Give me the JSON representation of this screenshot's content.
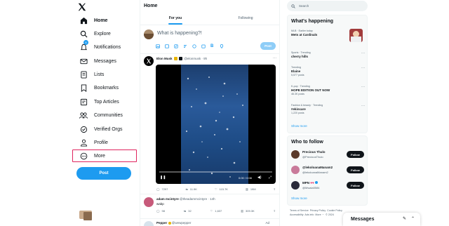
{
  "nav": {
    "items": [
      {
        "label": "Home",
        "icon": "home-icon"
      },
      {
        "label": "Explore",
        "icon": "search-icon"
      },
      {
        "label": "Notifications",
        "icon": "bell-icon",
        "badge": "8"
      },
      {
        "label": "Messages",
        "icon": "mail-icon"
      },
      {
        "label": "Lists",
        "icon": "lists-icon"
      },
      {
        "label": "Bookmarks",
        "icon": "bookmark-icon"
      },
      {
        "label": "Top Articles",
        "icon": "articles-icon"
      },
      {
        "label": "Communities",
        "icon": "communities-icon"
      },
      {
        "label": "Verified Orgs",
        "icon": "verified-icon"
      },
      {
        "label": "Profile",
        "icon": "person-icon"
      },
      {
        "label": "More",
        "icon": "more-circle-icon"
      }
    ],
    "post_button": "Post"
  },
  "main": {
    "title": "Home",
    "tabs": [
      {
        "label": "For you"
      },
      {
        "label": "Following"
      }
    ],
    "composer": {
      "placeholder": "What is happening?!",
      "post_label": "Post"
    },
    "tweets": [
      {
        "name": "Elon Musk",
        "handle": "@elonmusk · 9h",
        "video_time": "0:00 / 0:08",
        "stats": {
          "replies": "7297",
          "reposts": "11.9K",
          "likes": "115.7K",
          "views": "19M"
        }
      },
      {
        "name": "adam mcintyre",
        "handle": "@theadammcintyre · 14h",
        "text": "wabp",
        "stats": {
          "replies": "98",
          "reposts": "32",
          "likes": "1,637",
          "views": "309.3K"
        }
      },
      {
        "name": "Pepper",
        "handle": "@wewpepper",
        "badge": "Ad"
      }
    ]
  },
  "right": {
    "search_placeholder": "Search",
    "happening": {
      "title": "What's happening",
      "trends": [
        {
          "context": "MLB · Earlier today",
          "topic": "Mets at Cardinals",
          "count": ""
        },
        {
          "context": "Sports · Trending",
          "topic": "cherry hills",
          "count": ""
        },
        {
          "context": "Trending",
          "topic": "Elaine",
          "count": "5,577 posts"
        },
        {
          "context": "K-pop · Trending",
          "topic": "HOPE EDITION OUT NOW",
          "count": "46.3K posts"
        },
        {
          "context": "Fashion & beauty · Trending",
          "topic": "#ekincare",
          "count": "1,220 posts"
        }
      ],
      "show_more": "Show more"
    },
    "follow": {
      "title": "Who to follow",
      "people": [
        {
          "name": "Precious Thulo",
          "handle": "@PreciousThulo",
          "button": "Follow"
        },
        {
          "name": "@lekoloanaManam2",
          "handle": "@lekoloanaManam2",
          "button": "Follow"
        },
        {
          "name": "MPN",
          "handle": "@Mwala5584",
          "button": "Follow"
        }
      ],
      "show_more": "Show more"
    },
    "footer": [
      "Terms of Service",
      "Privacy Policy",
      "Cookie Policy",
      "Accessibility",
      "Ads info",
      "More ···",
      "© 2024"
    ]
  },
  "messages_drawer": {
    "title": "Messages"
  }
}
